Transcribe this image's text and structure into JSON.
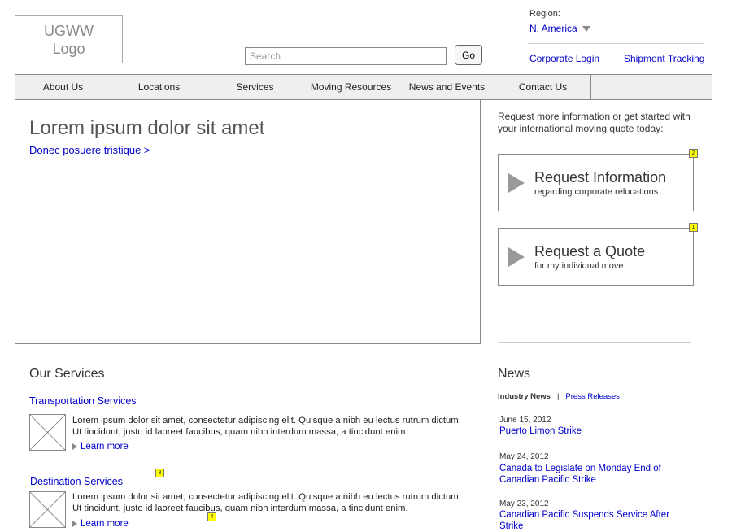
{
  "header": {
    "logo_line1": "UGWW",
    "logo_line2": "Logo",
    "search_placeholder": "Search",
    "go_label": "Go",
    "region_label": "Region:",
    "region_value": "N. America",
    "corporate_login": "Corporate Login",
    "shipment_tracking": "Shipment Tracking"
  },
  "nav": {
    "items": [
      "About Us",
      "Locations",
      "Services",
      "Moving Resources",
      "News and Events",
      "Contact Us"
    ]
  },
  "hero": {
    "title": "Lorem ipsum dolor sit amet",
    "link": "Donec posuere tristique >"
  },
  "sidebar": {
    "intro": "Request more information or get started with your international moving quote today:",
    "cta_info": {
      "title": "Request Information",
      "subtitle": "regarding corporate relocations",
      "note": "2"
    },
    "cta_quote": {
      "title": "Request a Quote",
      "subtitle": "for my individual move",
      "note": "1"
    }
  },
  "services": {
    "heading": "Our Services",
    "items": [
      {
        "title": "Transportation Services",
        "text": "Lorem ipsum dolor sit amet, consectetur adipiscing elit. Quisque a nibh eu lectus rutrum dictum. Ut tincidunt, justo id laoreet faucibus, quam nibh interdum massa, a tincidunt enim.",
        "learn_more": "Learn more"
      },
      {
        "title": "Destination Services",
        "text": "Lorem ipsum dolor sit amet, consectetur adipiscing elit. Quisque a nibh eu lectus rutrum dictum. Ut tincidunt, justo id laoreet faucibus, quam nibh interdum massa, a tincidunt enim.",
        "learn_more": "Learn more"
      }
    ],
    "note_3": "3",
    "note_4": "4"
  },
  "news": {
    "heading": "News",
    "tab_industry": "Industry News",
    "tab_separator": "|",
    "tab_press": "Press Releases",
    "items": [
      {
        "date": "June 15, 2012",
        "title": "Puerto Limon Strike"
      },
      {
        "date": "May 24, 2012",
        "title": "Canada to Legislate on Monday End of Canadian Pacific Strike"
      },
      {
        "date": "May 23, 2012",
        "title": "Canadian Pacific Suspends Service After Strike"
      }
    ]
  },
  "colors": {
    "link": "#0000cc",
    "note": "#ffff00",
    "nav_bg": "#efefef"
  },
  "icons": {
    "placeholder": "image-placeholder-icon",
    "play": "play-icon",
    "dropdown": "chevron-down-icon"
  }
}
